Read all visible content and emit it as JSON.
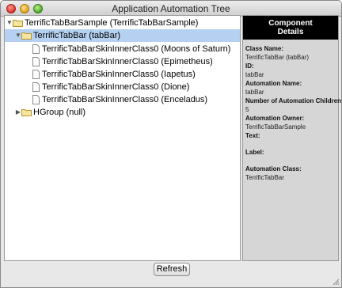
{
  "window": {
    "title": "Application Automation Tree"
  },
  "tree": {
    "rows": [
      {
        "label": "TerrificTabBarSample (TerrificTabBarSample)",
        "icon": "folder-icon",
        "expanded": true,
        "selected": false
      },
      {
        "label": "TerrificTabBar (tabBar)",
        "icon": "folder-icon",
        "expanded": true,
        "selected": true
      },
      {
        "label": "TerrificTabBarSkinInnerClass0 (Moons of Saturn)",
        "icon": "document-icon",
        "selected": false
      },
      {
        "label": "TerrificTabBarSkinInnerClass0 (Epimetheus)",
        "icon": "document-icon",
        "selected": false
      },
      {
        "label": "TerrificTabBarSkinInnerClass0 (Iapetus)",
        "icon": "document-icon",
        "selected": false
      },
      {
        "label": "TerrificTabBarSkinInnerClass0 (Dione)",
        "icon": "document-icon",
        "selected": false
      },
      {
        "label": "TerrificTabBarSkinInnerClass0 (Enceladus)",
        "icon": "document-icon",
        "selected": false
      },
      {
        "label": "HGroup (null)",
        "icon": "folder-icon",
        "expanded": false,
        "selected": false
      }
    ]
  },
  "details": {
    "header_line1": "Component",
    "header_line2": "Details",
    "class_name_label": "Class Name:",
    "class_name_value": "TerrificTabBar (tabBar)",
    "id_label": "ID:",
    "id_value": "tabBar",
    "automation_name_label": "Automation Name:",
    "automation_name_value": "tabBar",
    "children_label": "Number of Automation Children:",
    "children_value": "5",
    "owner_label": "Automation Owner:",
    "owner_value": "TerrificTabBarSample",
    "text_label": "Text:",
    "label_label": "Label:",
    "automation_class_label": "Automation Class:",
    "automation_class_value": "TerrificTabBar"
  },
  "footer": {
    "refresh_label": "Refresh"
  },
  "colors": {
    "selection": "#b5d0f0",
    "details_header_bg": "#000000",
    "details_bg": "#d6d6d6"
  }
}
